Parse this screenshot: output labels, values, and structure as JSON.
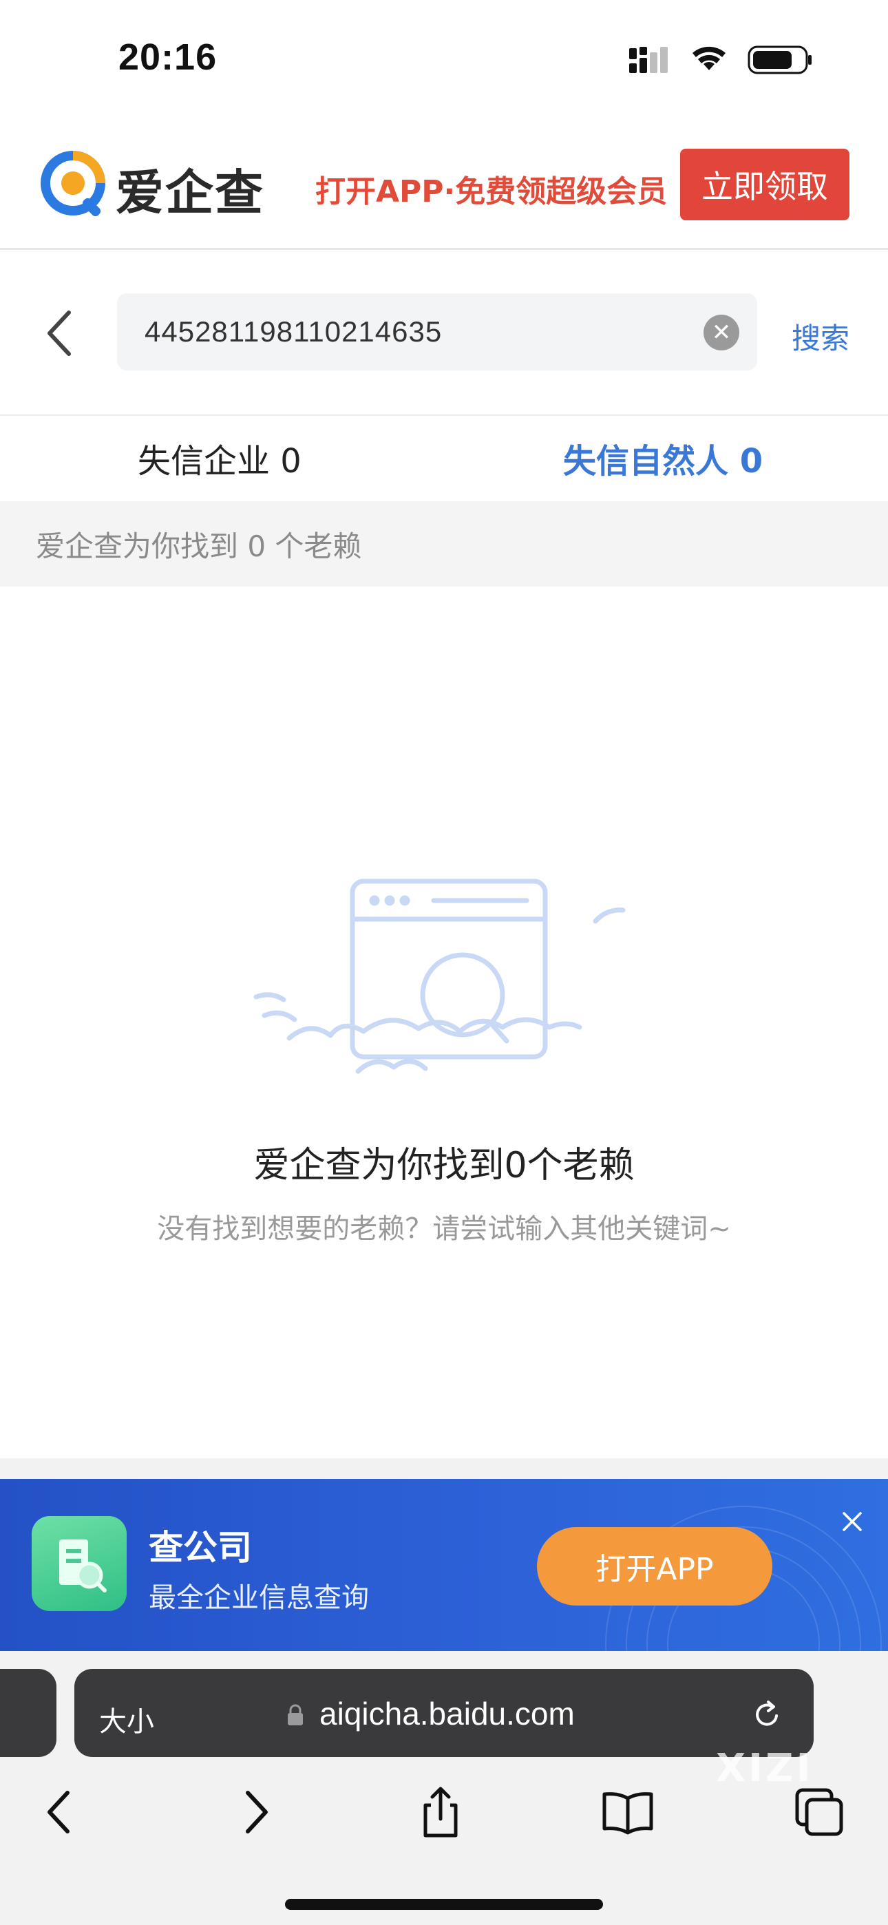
{
  "status": {
    "time": "20:16"
  },
  "header": {
    "brand": "爱企查",
    "promo": "打开APP·免费领超级会员",
    "claim_label": "立即领取",
    "accent": "#e2463a"
  },
  "search": {
    "value": "445281198110214635",
    "submit_label": "搜索",
    "back_icon": "chevron-left-icon",
    "clear_icon": "clear-icon"
  },
  "tabs": [
    {
      "label": "失信企业 0",
      "active": false
    },
    {
      "label": "失信自然人 0",
      "active": true
    }
  ],
  "result_summary": "爱企查为你找到 0 个老赖",
  "empty_state": {
    "title": "爱企查为你找到0个老赖",
    "subtitle": "没有找到想要的老赖？请尝试输入其他关键词~"
  },
  "app_banner": {
    "name": "查公司",
    "description": "最全企业信息查询",
    "open_label": "打开APP",
    "button_color": "#f59a3c"
  },
  "browser": {
    "aa_label": "大小",
    "url": "aiqicha.baidu.com",
    "watermark": "XIZI"
  },
  "colors": {
    "link_blue": "#3a78d8"
  }
}
